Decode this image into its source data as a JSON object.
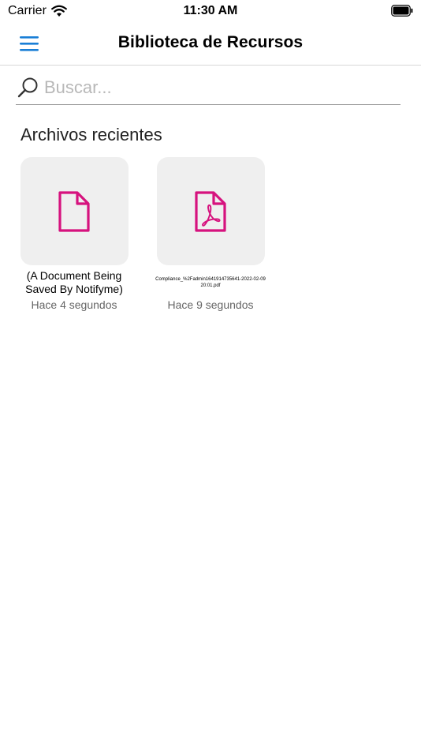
{
  "status_bar": {
    "carrier": "Carrier",
    "time": "11:30 AM"
  },
  "header": {
    "title": "Biblioteca de Recursos",
    "menu_icon": "hamburger-menu-icon"
  },
  "search": {
    "placeholder": "Buscar...",
    "value": "",
    "icon": "search-icon"
  },
  "recent": {
    "title": "Archivos recientes",
    "files": [
      {
        "name": "(A Document Being Saved By Notifyme)",
        "time": "Hace 4 segundos",
        "icon": "document-icon"
      },
      {
        "name": "Compliance_%2Fadmin1641914735641-2022-02-09 20:01.pdf",
        "time": "Hace 9 segundos",
        "icon": "pdf-icon"
      }
    ]
  },
  "colors": {
    "accent": "#1a7fd6",
    "file_icon": "#d6127e",
    "thumb_bg": "#efefef"
  }
}
